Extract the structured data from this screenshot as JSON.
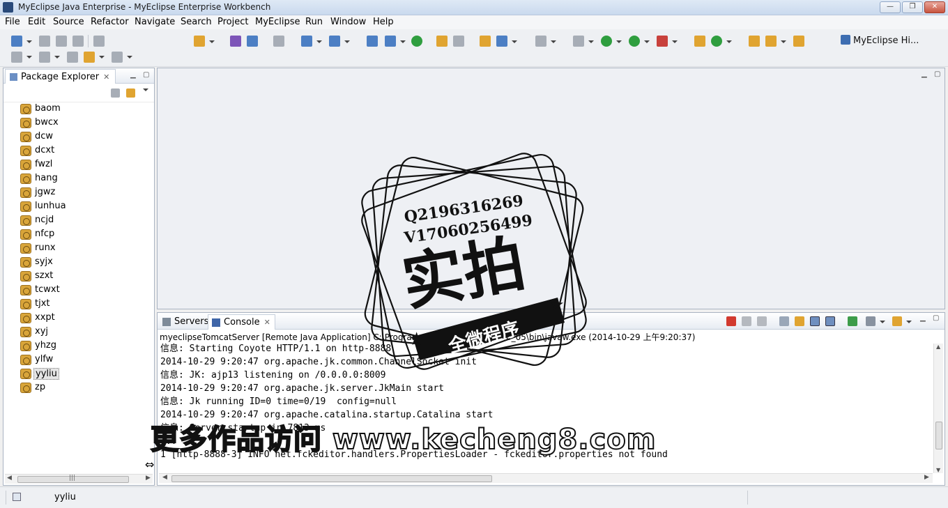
{
  "window": {
    "title": "MyEclipse Java Enterprise - MyEclipse Enterprise Workbench",
    "minimize_glyph": "—",
    "maximize_glyph": "❐",
    "close_glyph": "✕"
  },
  "menu": {
    "items": [
      "File",
      "Edit",
      "Source",
      "Refactor",
      "Navigate",
      "Search",
      "Project",
      "MyEclipse",
      "Run",
      "Window",
      "Help"
    ]
  },
  "toolbar": {
    "perspective_label": "MyEclipse Hi..."
  },
  "package_explorer": {
    "tab_label": "Package Explorer",
    "close_glyph": "✕",
    "projects": [
      "baom",
      "bwcx",
      "dcw",
      "dcxt",
      "fwzl",
      "hang",
      "jgwz",
      "lunhua",
      "ncjd",
      "nfcp",
      "runx",
      "syjx",
      "szxt",
      "tcwxt",
      "tjxt",
      "xxpt",
      "xyj",
      "yhzg",
      "ylfw",
      "yyliu",
      "zp"
    ],
    "selected_project": "yyliu",
    "scroll_mid_glyph": "|||"
  },
  "console": {
    "tabs": [
      {
        "label": "Servers",
        "icon": "servers-icon"
      },
      {
        "label": "Console",
        "icon": "console-icon",
        "active": true
      }
    ],
    "description": "myeclipseTomcatServer [Remote Java Application] C:\\Program Files (x86)\\...\\jre1.6.0_05\\bin\\javaw.exe (2014-10-29 上午9:20:37)",
    "lines": [
      "信息: Starting Coyote HTTP/1.1 on http-8888",
      "2014-10-29 9:20:47 org.apache.jk.common.ChannelSocket init",
      "信息: JK: ajp13 listening on /0.0.0.0:8009",
      "2014-10-29 9:20:47 org.apache.jk.server.JkMain start",
      "信息: Jk running ID=0 time=0/19  config=null",
      "2014-10-29 9:20:47 org.apache.catalina.startup.Catalina start",
      "信息: Server startup in 7813 ms",
      "... ...",
      "1 [http-8888-3] INFO net.fckeditor.handlers.PropertiesLoader - fckeditor.properties not found"
    ]
  },
  "status_bar": {
    "selected_item": "yyliu"
  },
  "watermark": {
    "contact_q": "Q2196316269",
    "contact_v": "V17060256499",
    "stamp_main": "实拍",
    "stamp_banner": "全微程序",
    "bottom_text": "更多作品访问 www.kecheng8.com"
  },
  "colors": {
    "accent": "#4c7fc4",
    "terminate_red": "#d23a2f",
    "window_chrome": "#c9d9ee"
  }
}
